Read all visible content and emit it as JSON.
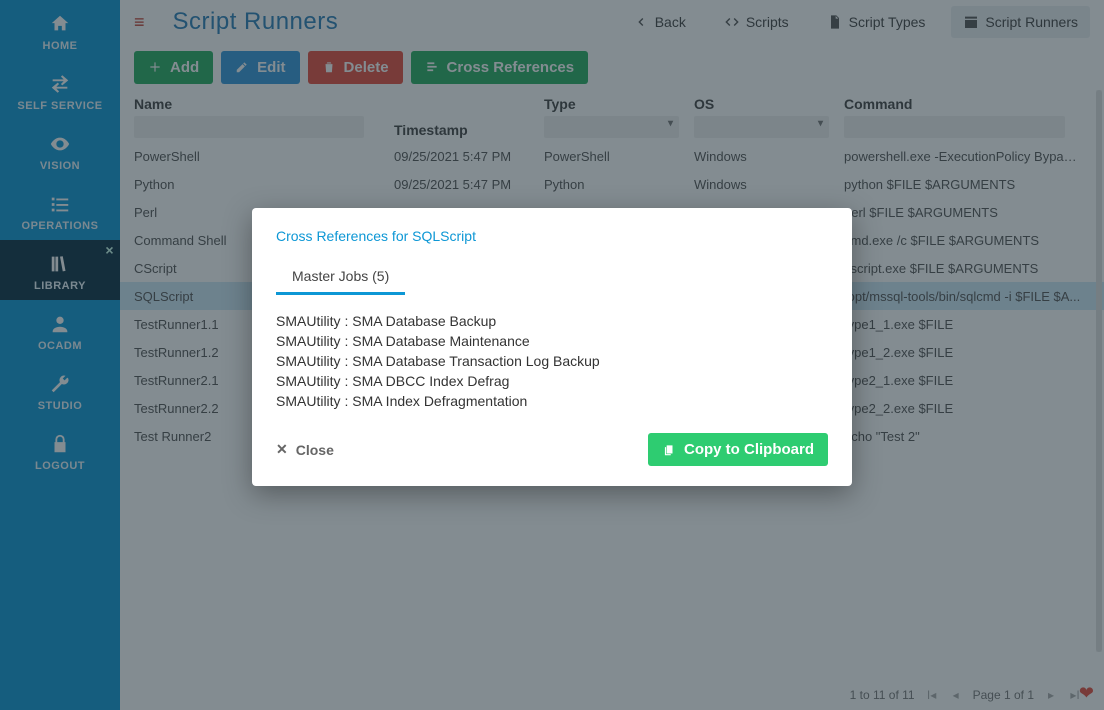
{
  "sidebar": {
    "items": [
      {
        "key": "home",
        "label": "HOME"
      },
      {
        "key": "selfservice",
        "label": "SELF SERVICE"
      },
      {
        "key": "vision",
        "label": "VISION"
      },
      {
        "key": "operations",
        "label": "OPERATIONS"
      },
      {
        "key": "library",
        "label": "LIBRARY"
      },
      {
        "key": "ocadm",
        "label": "OCADM"
      },
      {
        "key": "studio",
        "label": "STUDIO"
      },
      {
        "key": "logout",
        "label": "LOGOUT"
      }
    ],
    "active_key": "library"
  },
  "page": {
    "title": "Script Runners"
  },
  "tabs": {
    "back": "Back",
    "scripts": "Scripts",
    "script_types": "Script Types",
    "script_runners": "Script Runners",
    "active": "script_runners"
  },
  "toolbar": {
    "add": "Add",
    "edit": "Edit",
    "delete": "Delete",
    "cross_references": "Cross References"
  },
  "grid": {
    "columns": [
      "Name",
      "Timestamp",
      "Type",
      "OS",
      "Command"
    ],
    "rows": [
      {
        "name": "PowerShell",
        "timestamp": "09/25/2021 5:47 PM",
        "type": "PowerShell",
        "os": "Windows",
        "command": "powershell.exe -ExecutionPolicy Bypass -F..."
      },
      {
        "name": "Python",
        "timestamp": "09/25/2021 5:47 PM",
        "type": "Python",
        "os": "Windows",
        "command": "python $FILE $ARGUMENTS"
      },
      {
        "name": "Perl",
        "timestamp": "",
        "type": "",
        "os": "",
        "command": "perl $FILE $ARGUMENTS"
      },
      {
        "name": "Command Shell",
        "timestamp": "",
        "type": "",
        "os": "",
        "command": "cmd.exe /c $FILE $ARGUMENTS"
      },
      {
        "name": "CScript",
        "timestamp": "",
        "type": "",
        "os": "",
        "command": "cscript.exe $FILE $ARGUMENTS"
      },
      {
        "name": "SQLScript",
        "timestamp": "",
        "type": "",
        "os": "",
        "command": "/opt/mssql-tools/bin/sqlcmd -i $FILE $A...",
        "selected": true
      },
      {
        "name": "TestRunner1.1",
        "timestamp": "",
        "type": "",
        "os": "",
        "command": "type1_1.exe $FILE"
      },
      {
        "name": "TestRunner1.2",
        "timestamp": "",
        "type": "",
        "os": "",
        "command": "type1_2.exe $FILE"
      },
      {
        "name": "TestRunner2.1",
        "timestamp": "",
        "type": "",
        "os": "",
        "command": "type2_1.exe $FILE"
      },
      {
        "name": "TestRunner2.2",
        "timestamp": "",
        "type": "",
        "os": "",
        "command": "type2_2.exe $FILE"
      },
      {
        "name": "Test Runner2",
        "timestamp": "",
        "type": "",
        "os": "",
        "command": "echo \"Test 2\""
      }
    ]
  },
  "pager": {
    "range": "1 to 11 of 11",
    "page": "Page 1 of 1"
  },
  "modal": {
    "title": "Cross References for SQLScript",
    "tab": "Master Jobs (5)",
    "items": [
      "SMAUtility : SMA Database Backup",
      "SMAUtility : SMA Database Maintenance",
      "SMAUtility : SMA Database Transaction Log Backup",
      "SMAUtility : SMA DBCC Index Defrag",
      "SMAUtility : SMA Index Defragmentation"
    ],
    "close": "Close",
    "copy": "Copy to Clipboard"
  }
}
